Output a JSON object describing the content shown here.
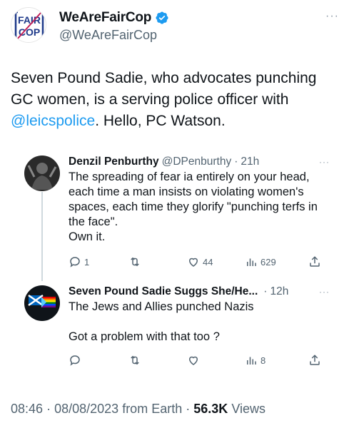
{
  "main_tweet": {
    "display_name": "WeAreFairCop",
    "handle": "@WeAreFairCop",
    "more": "···",
    "avatar_text": [
      "FAIR",
      "COP"
    ],
    "text_before": "Seven Pound Sadie, who advocates punching GC women,  is a serving police officer with ",
    "mention": "@leicspolice",
    "text_after": ". Hello, PC Watson."
  },
  "replies": [
    {
      "display_name": "Denzil Penburthy",
      "handle": "@DPenburthy",
      "separator": "·",
      "time": "21h",
      "more": "···",
      "text": "The spreading of fear ia entirely on your head, each time a man insists on violating women's spaces, each time they glorify \"punching terfs in the face\".\nOwn it.",
      "actions": {
        "replies": "1",
        "retweets": "",
        "likes": "44",
        "views": "629"
      }
    },
    {
      "display_name": "Seven Pound Sadie Suggs She/He...",
      "handle": "",
      "separator": "·",
      "time": "12h",
      "more": "···",
      "text": "The Jews and Allies punched Nazis\n\nGot a problem with that too ?",
      "actions": {
        "replies": "",
        "retweets": "",
        "likes": "",
        "views": "8"
      }
    }
  ],
  "footer": {
    "time": "08:46",
    "separator": "·",
    "date": "08/08/2023",
    "source": "from Earth",
    "views_count": "56.3K",
    "views_label": "Views"
  },
  "colors": {
    "text": "#0f1419",
    "secondary": "#536471",
    "link": "#1d9bf0",
    "verified": "#1d9bf0"
  }
}
